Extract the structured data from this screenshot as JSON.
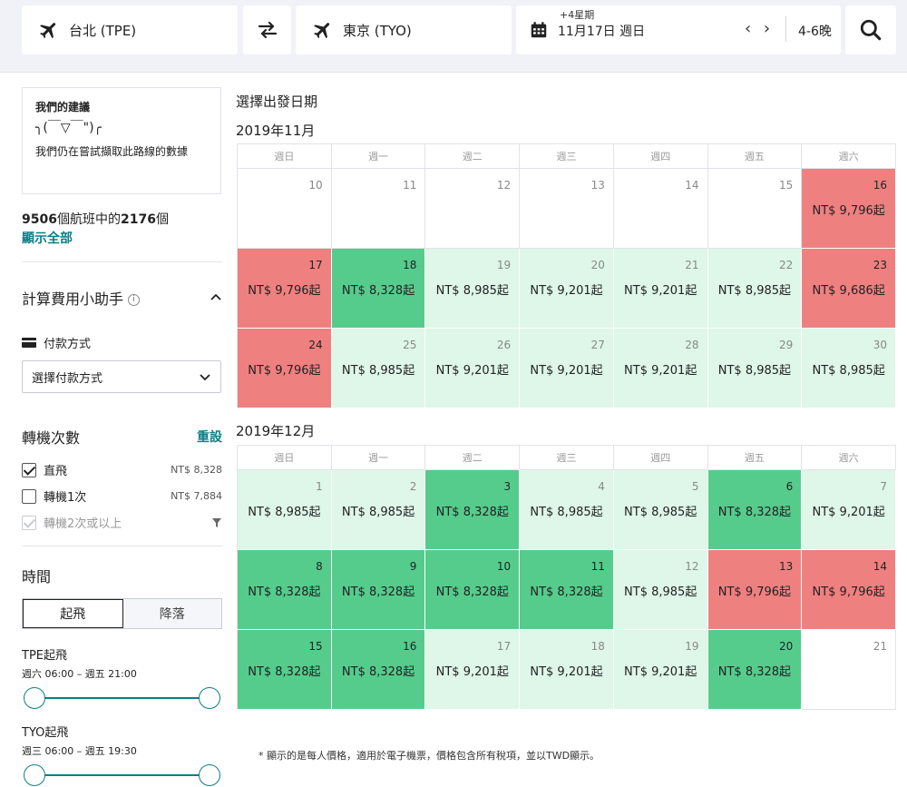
{
  "search": {
    "origin": "台北 (TPE)",
    "destination": "東京 (TYO)",
    "date_top": "+4星期",
    "date_main": "11月17日 週日",
    "date_arrows": "‹ ›",
    "nights": "4-6晚"
  },
  "sidebar": {
    "suggestion_title": "我們的建議",
    "suggestion_kaomoji": "╮(￣▽￣\")╭",
    "suggestion_text": "我們仍在嘗試擷取此路線的數據",
    "count_total": "9506",
    "count_mid": "個航班中的",
    "count_shown": "2176",
    "count_unit": "個",
    "show_all": "顯示全部",
    "fee_helper_title": "計算費用小助手",
    "payment_label": "付款方式",
    "payment_select": "選擇付款方式",
    "stops_title": "轉機次數",
    "stops_reset": "重設",
    "stops": [
      {
        "label": "直飛",
        "price": "NT$ 8,328"
      },
      {
        "label": "轉機1次",
        "price": "NT$ 7,884"
      },
      {
        "label": "轉機2次或以上",
        "price": ""
      }
    ],
    "time_title": "時間",
    "time_tabs": [
      "起飛",
      "降落"
    ],
    "tpe_title": "TPE起飛",
    "tpe_range": "週六 06:00 – 週五 21:00",
    "tyo_title": "TYO起飛",
    "tyo_range": "週三 06:00 – 週五 19:30"
  },
  "calendar": {
    "heading": "選擇出發日期",
    "weekdays": [
      "週日",
      "週一",
      "週二",
      "週三",
      "週四",
      "週五",
      "週六"
    ],
    "months": [
      {
        "title": "2019年11月",
        "days": [
          {
            "d": "10",
            "p": "",
            "c": "empty"
          },
          {
            "d": "11",
            "p": "",
            "c": "empty"
          },
          {
            "d": "12",
            "p": "",
            "c": "empty"
          },
          {
            "d": "13",
            "p": "",
            "c": "empty"
          },
          {
            "d": "14",
            "p": "",
            "c": "empty"
          },
          {
            "d": "15",
            "p": "",
            "c": "empty"
          },
          {
            "d": "16",
            "p": "NT$ 9,796起",
            "c": "red"
          },
          {
            "d": "17",
            "p": "NT$ 9,796起",
            "c": "red"
          },
          {
            "d": "18",
            "p": "NT$ 8,328起",
            "c": "green"
          },
          {
            "d": "19",
            "p": "NT$ 8,985起",
            "c": "light"
          },
          {
            "d": "20",
            "p": "NT$ 9,201起",
            "c": "light"
          },
          {
            "d": "21",
            "p": "NT$ 9,201起",
            "c": "light"
          },
          {
            "d": "22",
            "p": "NT$ 8,985起",
            "c": "light"
          },
          {
            "d": "23",
            "p": "NT$ 9,686起",
            "c": "red"
          },
          {
            "d": "24",
            "p": "NT$ 9,796起",
            "c": "red"
          },
          {
            "d": "25",
            "p": "NT$ 8,985起",
            "c": "light"
          },
          {
            "d": "26",
            "p": "NT$ 9,201起",
            "c": "light"
          },
          {
            "d": "27",
            "p": "NT$ 9,201起",
            "c": "light"
          },
          {
            "d": "28",
            "p": "NT$ 9,201起",
            "c": "light"
          },
          {
            "d": "29",
            "p": "NT$ 8,985起",
            "c": "light"
          },
          {
            "d": "30",
            "p": "NT$ 8,985起",
            "c": "light"
          }
        ]
      },
      {
        "title": "2019年12月",
        "days": [
          {
            "d": "1",
            "p": "NT$ 8,985起",
            "c": "light"
          },
          {
            "d": "2",
            "p": "NT$ 8,985起",
            "c": "light"
          },
          {
            "d": "3",
            "p": "NT$ 8,328起",
            "c": "green"
          },
          {
            "d": "4",
            "p": "NT$ 8,985起",
            "c": "light"
          },
          {
            "d": "5",
            "p": "NT$ 8,985起",
            "c": "light"
          },
          {
            "d": "6",
            "p": "NT$ 8,328起",
            "c": "green"
          },
          {
            "d": "7",
            "p": "NT$ 9,201起",
            "c": "light"
          },
          {
            "d": "8",
            "p": "NT$ 8,328起",
            "c": "green"
          },
          {
            "d": "9",
            "p": "NT$ 8,328起",
            "c": "green"
          },
          {
            "d": "10",
            "p": "NT$ 8,328起",
            "c": "green"
          },
          {
            "d": "11",
            "p": "NT$ 8,328起",
            "c": "green"
          },
          {
            "d": "12",
            "p": "NT$ 8,985起",
            "c": "light"
          },
          {
            "d": "13",
            "p": "NT$ 9,796起",
            "c": "red"
          },
          {
            "d": "14",
            "p": "NT$ 9,796起",
            "c": "red"
          },
          {
            "d": "15",
            "p": "NT$ 8,328起",
            "c": "green"
          },
          {
            "d": "16",
            "p": "NT$ 8,328起",
            "c": "green"
          },
          {
            "d": "17",
            "p": "NT$ 9,201起",
            "c": "light"
          },
          {
            "d": "18",
            "p": "NT$ 9,201起",
            "c": "light"
          },
          {
            "d": "19",
            "p": "NT$ 9,201起",
            "c": "light"
          },
          {
            "d": "20",
            "p": "NT$ 8,328起",
            "c": "green"
          },
          {
            "d": "21",
            "p": "",
            "c": "empty"
          }
        ]
      }
    ],
    "footnote": "* 顯示的是每人價格，適用於電子機票，價格包含所有稅項，並以TWD顯示。"
  },
  "colors": {
    "accent": "#0b7f87",
    "price_high": "#ef8080",
    "price_low": "#55cc8c",
    "price_mid": "#def7e8"
  },
  "icons": [
    "plane-icon",
    "swap-icon",
    "calendar-icon",
    "search-icon",
    "info-icon",
    "chevron-up-icon",
    "chevron-down-icon",
    "card-icon",
    "filter-icon"
  ]
}
